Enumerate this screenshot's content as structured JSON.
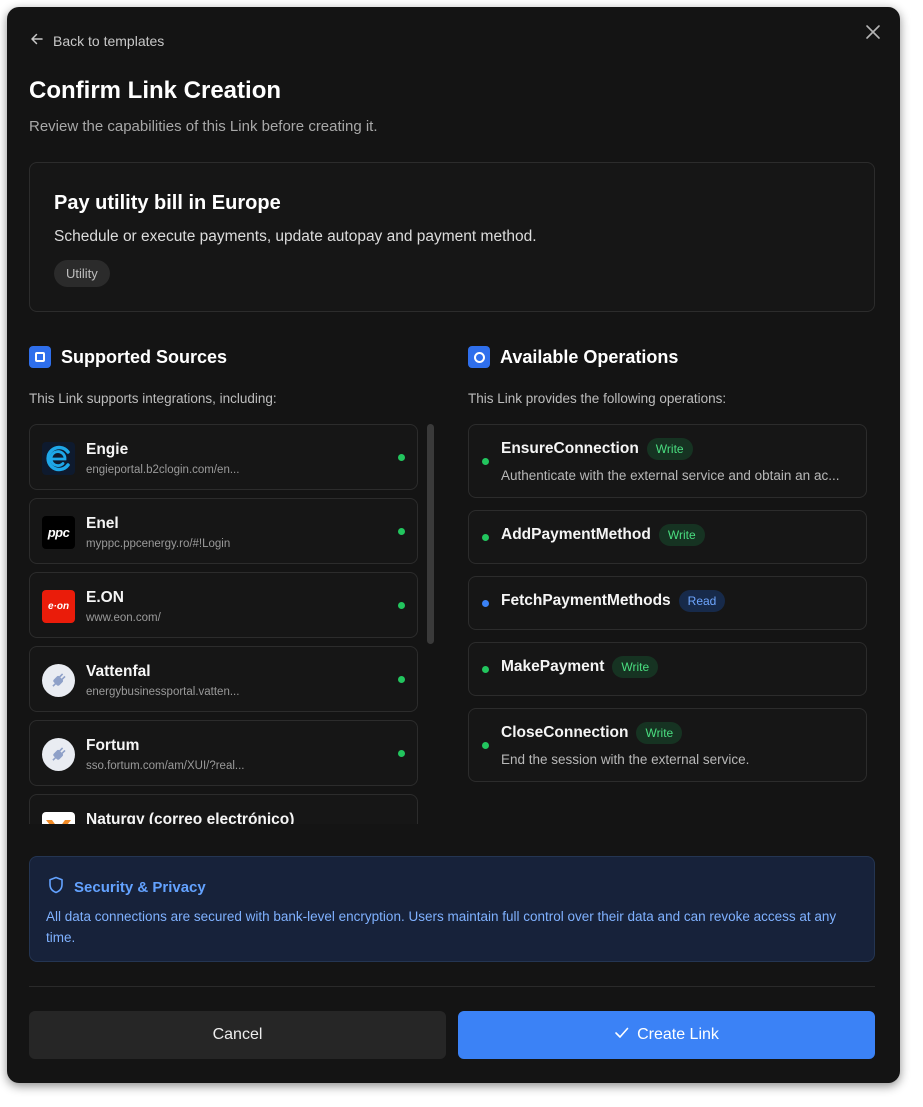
{
  "header": {
    "back_label": "Back to templates",
    "title": "Confirm Link Creation",
    "subtitle": "Review the capabilities of this Link before creating it."
  },
  "template": {
    "name": "Pay utility bill in Europe",
    "description": "Schedule or execute payments, update autopay and payment method.",
    "tag": "Utility"
  },
  "sources_section": {
    "title": "Supported Sources",
    "note": "This Link supports integrations, including:",
    "items": [
      {
        "name": "Engie",
        "url": "engieportal.b2clogin.com/en...",
        "icon": "engie-logo",
        "status": "available"
      },
      {
        "name": "Enel",
        "url": "myppc.ppcenergy.ro/#!Login",
        "icon": "ppc-logo",
        "logo_text": "ppc",
        "status": "available"
      },
      {
        "name": "E.ON",
        "url": "www.eon.com/",
        "icon": "eon-logo",
        "logo_text": "e·on",
        "status": "available"
      },
      {
        "name": "Vattenfal",
        "url": "energybusinessportal.vatten...",
        "icon": "plug-icon",
        "status": "available"
      },
      {
        "name": "Fortum",
        "url": "sso.fortum.com/am/XUI/?real...",
        "icon": "plug-icon",
        "status": "available"
      },
      {
        "name": "Naturgy (correo electrónico)",
        "url": "",
        "icon": "naturgy-logo",
        "status": "available"
      }
    ]
  },
  "operations_section": {
    "title": "Available Operations",
    "note": "This Link provides the following operations:",
    "items": [
      {
        "name": "EnsureConnection",
        "badge": "Write",
        "description": "Authenticate with the external service and obtain an ac..."
      },
      {
        "name": "AddPaymentMethod",
        "badge": "Write",
        "description": ""
      },
      {
        "name": "FetchPaymentMethods",
        "badge": "Read",
        "description": ""
      },
      {
        "name": "MakePayment",
        "badge": "Write",
        "description": ""
      },
      {
        "name": "CloseConnection",
        "badge": "Write",
        "description": "End the session with the external service."
      }
    ]
  },
  "security": {
    "title": "Security & Privacy",
    "text": "All data connections are secured with bank-level encryption. Users maintain full control over their data and can revoke access at any time."
  },
  "footer": {
    "cancel_label": "Cancel",
    "create_label": "Create Link"
  },
  "colors": {
    "accent": "#3b82f6",
    "write_badge": "#4ade80",
    "read_badge": "#6ea6ff",
    "status_green": "#22c55e",
    "background": "#141414"
  }
}
